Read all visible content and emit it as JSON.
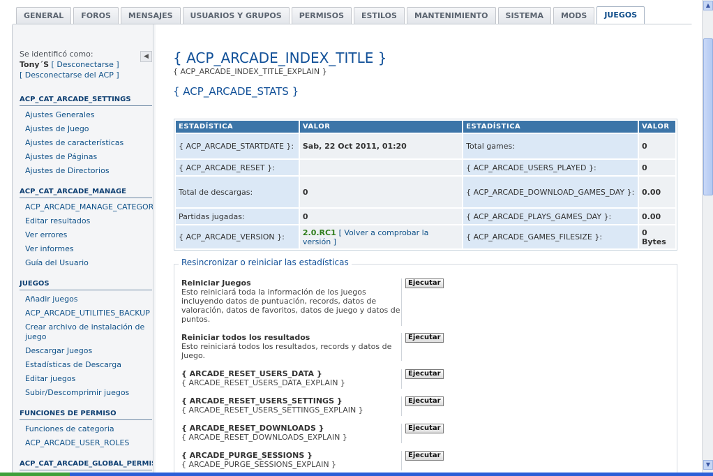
{
  "tabs": [
    {
      "label": "GENERAL",
      "active": false
    },
    {
      "label": "FOROS",
      "active": false
    },
    {
      "label": "MENSAJES",
      "active": false
    },
    {
      "label": "USUARIOS Y GRUPOS",
      "active": false
    },
    {
      "label": "PERMISOS",
      "active": false
    },
    {
      "label": "ESTILOS",
      "active": false
    },
    {
      "label": "MANTENIMIENTO",
      "active": false
    },
    {
      "label": "SISTEMA",
      "active": false
    },
    {
      "label": "MODS",
      "active": false
    },
    {
      "label": "JUEGOS",
      "active": true
    }
  ],
  "sidebar": {
    "identified_as": "Se identificó como:",
    "username": "Tony´S",
    "logout": "[ Desconectarse ]",
    "logout_acp": "[ Desconectarse del ACP ]",
    "collapse_icon": "◀",
    "categories": [
      {
        "title": "ACP_CAT_ARCADE_SETTINGS",
        "items": [
          "Ajustes Generales",
          "Ajustes de Juego",
          "Ajustes de características",
          "Ajustes de Páginas",
          "Ajustes de Directorios"
        ]
      },
      {
        "title": "ACP_CAT_ARCADE_MANAGE",
        "items": [
          "ACP_ARCADE_MANAGE_CATEGORIES",
          "Editar resultados",
          "Ver errores",
          "Ver informes",
          "Guía del Usuario"
        ]
      },
      {
        "title": "JUEGOS",
        "items": [
          "Añadir juegos",
          "ACP_ARCADE_UTILITIES_BACKUP",
          "Crear archivo de instalación de juego",
          "Descargar Juegos",
          "Estadísticas de Descarga",
          "Editar juegos",
          "Subir/Descomprimir juegos"
        ]
      },
      {
        "title": "FUNCIONES DE PERMISO",
        "items": [
          "Funciones de categoria",
          "ACP_ARCADE_USER_ROLES"
        ]
      },
      {
        "title": "ACP_CAT_ARCADE_GLOBAL_PERMISSIONS",
        "items": []
      }
    ]
  },
  "main": {
    "title": "{ ACP_ARCADE_INDEX_TITLE }",
    "title_explain": "{ ACP_ARCADE_INDEX_TITLE_EXPLAIN }",
    "stats_title": "{ ACP_ARCADE_STATS }",
    "stats_table": {
      "headers": [
        "ESTADÍSTICA",
        "VALOR",
        "ESTADÍSTICA",
        "VALOR"
      ],
      "rows": [
        [
          "{ ACP_ARCADE_STARTDATE }:",
          "Sab, 22 Oct 2011, 01:20",
          "Total games:",
          "0"
        ],
        [
          "{ ACP_ARCADE_RESET }:",
          "",
          "{ ACP_ARCADE_USERS_PLAYED }:",
          "0"
        ],
        [
          "Total de descargas:",
          "0",
          "{ ACP_ARCADE_DOWNLOAD_GAMES_DAY }:",
          "0.00"
        ],
        [
          "Partidas jugadas:",
          "0",
          "{ ACP_ARCADE_PLAYS_GAMES_DAY }:",
          "0.00"
        ],
        [
          "{ ACP_ARCADE_VERSION }:",
          "2.0.RC1",
          "{ ACP_ARCADE_GAMES_FILESIZE }:",
          "0 Bytes"
        ]
      ],
      "version_recheck": "[ Volver a comprobar la versión ]"
    },
    "reset_section": {
      "legend": "Resincronizar o reiniciar las estadísticas",
      "button_label": "Ejecutar",
      "items": [
        {
          "name": "Reiniciar Juegos",
          "desc": "Esto reiniciará toda la información de los juegos incluyendo datos de puntuación, records, datos de valoración, datos de favoritos, datos de juego y datos de puntos."
        },
        {
          "name": "Reiniciar todos los resultados",
          "desc": "Esto reiniciará todos los resultados, records y datos de Juego."
        },
        {
          "name": "{ ARCADE_RESET_USERS_DATA }",
          "desc": "{ ARCADE_RESET_USERS_DATA_EXPLAIN }"
        },
        {
          "name": "{ ARCADE_RESET_USERS_SETTINGS }",
          "desc": "{ ARCADE_RESET_USERS_SETTINGS_EXPLAIN }"
        },
        {
          "name": "{ ARCADE_RESET_DOWNLOADS }",
          "desc": "{ ARCADE_RESET_DOWNLOADS_EXPLAIN }"
        },
        {
          "name": "{ ARCADE_PURGE_SESSIONS }",
          "desc": "{ ARCADE_PURGE_SESSIONS_EXPLAIN }"
        }
      ]
    }
  },
  "scrollbar": {
    "up_icon": "▲",
    "down_icon": "▼"
  }
}
